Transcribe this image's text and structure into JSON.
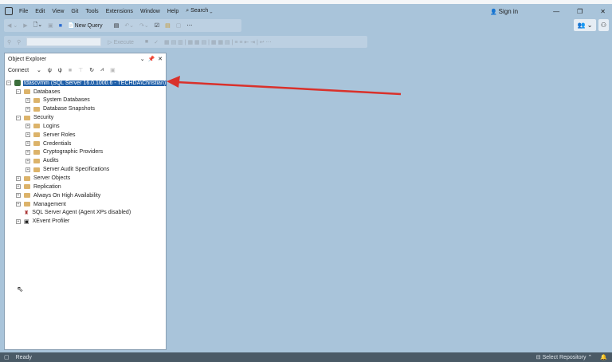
{
  "menu": [
    "File",
    "Edit",
    "View",
    "Git",
    "Tools",
    "Extensions",
    "Window",
    "Help",
    "Search"
  ],
  "signin": "Sign in",
  "toolbar": {
    "new_query": "New Query",
    "execute": "Execute"
  },
  "object_explorer": {
    "title": "Object Explorer",
    "connect": "Connect",
    "server": "tdascvmm (SQL Server 16.0.1000.6 - TECHDA\\Christian)",
    "items": [
      {
        "label": "Databases",
        "level": 1,
        "expanded": true
      },
      {
        "label": "System Databases",
        "level": 2
      },
      {
        "label": "Database Snapshots",
        "level": 2
      },
      {
        "label": "Security",
        "level": 1,
        "expanded": true
      },
      {
        "label": "Logins",
        "level": 2
      },
      {
        "label": "Server Roles",
        "level": 2
      },
      {
        "label": "Credentials",
        "level": 2
      },
      {
        "label": "Cryptographic Providers",
        "level": 2
      },
      {
        "label": "Audits",
        "level": 2
      },
      {
        "label": "Server Audit Specifications",
        "level": 2
      },
      {
        "label": "Server Objects",
        "level": 1
      },
      {
        "label": "Replication",
        "level": 1
      },
      {
        "label": "Always On High Availability",
        "level": 1
      },
      {
        "label": "Management",
        "level": 1
      },
      {
        "label": "SQL Server Agent (Agent XPs disabled)",
        "level": 1,
        "icon": "agent"
      },
      {
        "label": "XEvent Profiler",
        "level": 1,
        "icon": "xevent"
      }
    ]
  },
  "status": {
    "ready": "Ready",
    "repo": "Select Repository"
  },
  "colors": {
    "arrow": "#d9312b",
    "selection": "#1f5fa8"
  }
}
